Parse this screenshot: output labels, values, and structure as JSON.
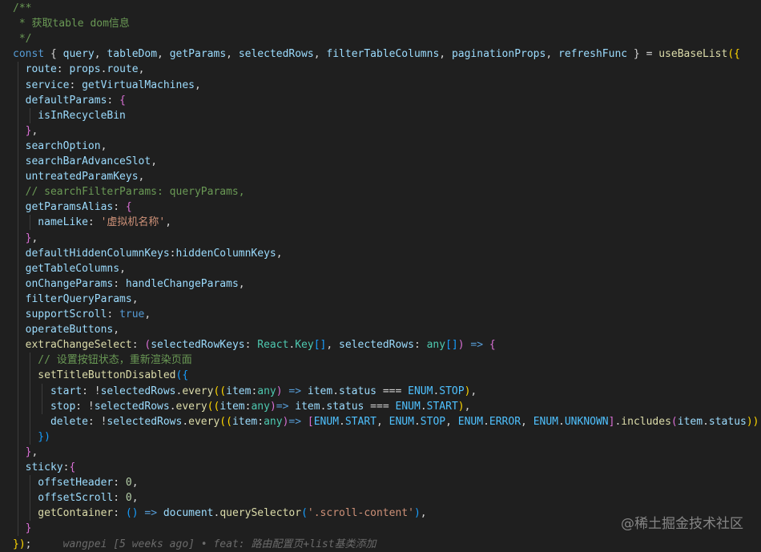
{
  "editor": {
    "lines": [
      [
        {
          "t": "/**",
          "c": "comment"
        }
      ],
      [
        {
          "t": " * 获取table dom信息",
          "c": "comment"
        }
      ],
      [
        {
          "t": " */",
          "c": "comment"
        }
      ],
      [
        {
          "t": "const",
          "c": "kw"
        },
        {
          "t": " { ",
          "c": "punc"
        },
        {
          "t": "query",
          "c": "var"
        },
        {
          "t": ", ",
          "c": "punc"
        },
        {
          "t": "tableDom",
          "c": "var"
        },
        {
          "t": ", ",
          "c": "punc"
        },
        {
          "t": "getParams",
          "c": "var"
        },
        {
          "t": ", ",
          "c": "punc"
        },
        {
          "t": "selectedRows",
          "c": "var"
        },
        {
          "t": ", ",
          "c": "punc"
        },
        {
          "t": "filterTableColumns",
          "c": "var"
        },
        {
          "t": ", ",
          "c": "punc"
        },
        {
          "t": "paginationProps",
          "c": "var"
        },
        {
          "t": ", ",
          "c": "punc"
        },
        {
          "t": "refreshFunc",
          "c": "var"
        },
        {
          "t": " } = ",
          "c": "punc"
        },
        {
          "t": "useBaseList",
          "c": "fn"
        },
        {
          "t": "({",
          "c": "brace1"
        }
      ],
      [
        {
          "t": "  route",
          "c": "var"
        },
        {
          "t": ": ",
          "c": "punc"
        },
        {
          "t": "props",
          "c": "var"
        },
        {
          "t": ".",
          "c": "punc"
        },
        {
          "t": "route",
          "c": "var"
        },
        {
          "t": ",",
          "c": "punc"
        }
      ],
      [
        {
          "t": "  service",
          "c": "var"
        },
        {
          "t": ": ",
          "c": "punc"
        },
        {
          "t": "getVirtualMachines",
          "c": "var"
        },
        {
          "t": ",",
          "c": "punc"
        }
      ],
      [
        {
          "t": "  defaultParams",
          "c": "var"
        },
        {
          "t": ": ",
          "c": "punc"
        },
        {
          "t": "{",
          "c": "brace2"
        }
      ],
      [
        {
          "t": "    isInRecycleBin",
          "c": "var"
        }
      ],
      [
        {
          "t": "  }",
          "c": "brace2"
        },
        {
          "t": ",",
          "c": "punc"
        }
      ],
      [
        {
          "t": "  searchOption",
          "c": "var"
        },
        {
          "t": ",",
          "c": "punc"
        }
      ],
      [
        {
          "t": "  searchBarAdvanceSlot",
          "c": "var"
        },
        {
          "t": ",",
          "c": "punc"
        }
      ],
      [
        {
          "t": "  untreatedParamKeys",
          "c": "var"
        },
        {
          "t": ",",
          "c": "punc"
        }
      ],
      [
        {
          "t": "  // searchFilterParams: queryParams,",
          "c": "comment"
        }
      ],
      [
        {
          "t": "  getParamsAlias",
          "c": "var"
        },
        {
          "t": ": ",
          "c": "punc"
        },
        {
          "t": "{",
          "c": "brace2"
        }
      ],
      [
        {
          "t": "    nameLike",
          "c": "var"
        },
        {
          "t": ": ",
          "c": "punc"
        },
        {
          "t": "'虚拟机名称'",
          "c": "str"
        },
        {
          "t": ",",
          "c": "punc"
        }
      ],
      [
        {
          "t": "  }",
          "c": "brace2"
        },
        {
          "t": ",",
          "c": "punc"
        }
      ],
      [
        {
          "t": "  defaultHiddenColumnKeys",
          "c": "var"
        },
        {
          "t": ":",
          "c": "punc"
        },
        {
          "t": "hiddenColumnKeys",
          "c": "var"
        },
        {
          "t": ",",
          "c": "punc"
        }
      ],
      [
        {
          "t": "  getTableColumns",
          "c": "var"
        },
        {
          "t": ",",
          "c": "punc"
        }
      ],
      [
        {
          "t": "  onChangeParams",
          "c": "var"
        },
        {
          "t": ": ",
          "c": "punc"
        },
        {
          "t": "handleChangeParams",
          "c": "var"
        },
        {
          "t": ",",
          "c": "punc"
        }
      ],
      [
        {
          "t": "  filterQueryParams",
          "c": "var"
        },
        {
          "t": ",",
          "c": "punc"
        }
      ],
      [
        {
          "t": "  supportScroll",
          "c": "var"
        },
        {
          "t": ": ",
          "c": "punc"
        },
        {
          "t": "true",
          "c": "kw"
        },
        {
          "t": ",",
          "c": "punc"
        }
      ],
      [
        {
          "t": "  operateButtons",
          "c": "var"
        },
        {
          "t": ",",
          "c": "punc"
        }
      ],
      [
        {
          "t": "  extraChangeSelect",
          "c": "fn"
        },
        {
          "t": ": ",
          "c": "punc"
        },
        {
          "t": "(",
          "c": "brace2"
        },
        {
          "t": "selectedRowKeys",
          "c": "param"
        },
        {
          "t": ": ",
          "c": "punc"
        },
        {
          "t": "React",
          "c": "type"
        },
        {
          "t": ".",
          "c": "punc"
        },
        {
          "t": "Key",
          "c": "type"
        },
        {
          "t": "[]",
          "c": "brace3"
        },
        {
          "t": ", ",
          "c": "punc"
        },
        {
          "t": "selectedRows",
          "c": "param"
        },
        {
          "t": ": ",
          "c": "punc"
        },
        {
          "t": "any",
          "c": "type"
        },
        {
          "t": "[]",
          "c": "brace3"
        },
        {
          "t": ")",
          "c": "brace2"
        },
        {
          "t": " => ",
          "c": "kw"
        },
        {
          "t": "{",
          "c": "brace2"
        }
      ],
      [
        {
          "t": "    // 设置按钮状态，重新渲染页面",
          "c": "comment"
        }
      ],
      [
        {
          "t": "    setTitleButtonDisabled",
          "c": "fn"
        },
        {
          "t": "({",
          "c": "brace3"
        }
      ],
      [
        {
          "t": "      start",
          "c": "var"
        },
        {
          "t": ": !",
          "c": "punc"
        },
        {
          "t": "selectedRows",
          "c": "var"
        },
        {
          "t": ".",
          "c": "punc"
        },
        {
          "t": "every",
          "c": "fn"
        },
        {
          "t": "((",
          "c": "brace1"
        },
        {
          "t": "item",
          "c": "param"
        },
        {
          "t": ":",
          "c": "punc"
        },
        {
          "t": "any",
          "c": "type"
        },
        {
          "t": ")",
          "c": "brace2"
        },
        {
          "t": " => ",
          "c": "kw"
        },
        {
          "t": "item",
          "c": "var"
        },
        {
          "t": ".",
          "c": "punc"
        },
        {
          "t": "status",
          "c": "var"
        },
        {
          "t": " === ",
          "c": "punc"
        },
        {
          "t": "ENUM",
          "c": "const"
        },
        {
          "t": ".",
          "c": "punc"
        },
        {
          "t": "STOP",
          "c": "const"
        },
        {
          "t": ")",
          "c": "brace1"
        },
        {
          "t": ",",
          "c": "punc"
        }
      ],
      [
        {
          "t": "      stop",
          "c": "var"
        },
        {
          "t": ": !",
          "c": "punc"
        },
        {
          "t": "selectedRows",
          "c": "var"
        },
        {
          "t": ".",
          "c": "punc"
        },
        {
          "t": "every",
          "c": "fn"
        },
        {
          "t": "((",
          "c": "brace1"
        },
        {
          "t": "item",
          "c": "param"
        },
        {
          "t": ":",
          "c": "punc"
        },
        {
          "t": "any",
          "c": "type"
        },
        {
          "t": ")",
          "c": "brace2"
        },
        {
          "t": "=> ",
          "c": "kw"
        },
        {
          "t": "item",
          "c": "var"
        },
        {
          "t": ".",
          "c": "punc"
        },
        {
          "t": "status",
          "c": "var"
        },
        {
          "t": " === ",
          "c": "punc"
        },
        {
          "t": "ENUM",
          "c": "const"
        },
        {
          "t": ".",
          "c": "punc"
        },
        {
          "t": "START",
          "c": "const"
        },
        {
          "t": ")",
          "c": "brace1"
        },
        {
          "t": ",",
          "c": "punc"
        }
      ],
      [
        {
          "t": "      delete",
          "c": "var"
        },
        {
          "t": ": !",
          "c": "punc"
        },
        {
          "t": "selectedRows",
          "c": "var"
        },
        {
          "t": ".",
          "c": "punc"
        },
        {
          "t": "every",
          "c": "fn"
        },
        {
          "t": "((",
          "c": "brace1"
        },
        {
          "t": "item",
          "c": "param"
        },
        {
          "t": ":",
          "c": "punc"
        },
        {
          "t": "any",
          "c": "type"
        },
        {
          "t": ")",
          "c": "brace2"
        },
        {
          "t": "=> ",
          "c": "kw"
        },
        {
          "t": "[",
          "c": "brace2"
        },
        {
          "t": "ENUM",
          "c": "const"
        },
        {
          "t": ".",
          "c": "punc"
        },
        {
          "t": "START",
          "c": "const"
        },
        {
          "t": ", ",
          "c": "punc"
        },
        {
          "t": "ENUM",
          "c": "const"
        },
        {
          "t": ".",
          "c": "punc"
        },
        {
          "t": "STOP",
          "c": "const"
        },
        {
          "t": ", ",
          "c": "punc"
        },
        {
          "t": "ENUM",
          "c": "const"
        },
        {
          "t": ".",
          "c": "punc"
        },
        {
          "t": "ERROR",
          "c": "const"
        },
        {
          "t": ", ",
          "c": "punc"
        },
        {
          "t": "ENUM",
          "c": "const"
        },
        {
          "t": ".",
          "c": "punc"
        },
        {
          "t": "UNKNOWN",
          "c": "const"
        },
        {
          "t": "]",
          "c": "brace2"
        },
        {
          "t": ".",
          "c": "punc"
        },
        {
          "t": "includes",
          "c": "fn"
        },
        {
          "t": "(",
          "c": "brace2"
        },
        {
          "t": "item",
          "c": "var"
        },
        {
          "t": ".",
          "c": "punc"
        },
        {
          "t": "status",
          "c": "var"
        },
        {
          "t": "))",
          "c": "brace1"
        }
      ],
      [
        {
          "t": "    })",
          "c": "brace3"
        }
      ],
      [
        {
          "t": "  }",
          "c": "brace2"
        },
        {
          "t": ",",
          "c": "punc"
        }
      ],
      [
        {
          "t": "  sticky",
          "c": "var"
        },
        {
          "t": ":",
          "c": "punc"
        },
        {
          "t": "{",
          "c": "brace2"
        }
      ],
      [
        {
          "t": "    offsetHeader",
          "c": "var"
        },
        {
          "t": ": ",
          "c": "punc"
        },
        {
          "t": "0",
          "c": "num"
        },
        {
          "t": ",",
          "c": "punc"
        }
      ],
      [
        {
          "t": "    offsetScroll",
          "c": "var"
        },
        {
          "t": ": ",
          "c": "punc"
        },
        {
          "t": "0",
          "c": "num"
        },
        {
          "t": ",",
          "c": "punc"
        }
      ],
      [
        {
          "t": "    getContainer",
          "c": "fn"
        },
        {
          "t": ": ",
          "c": "punc"
        },
        {
          "t": "()",
          "c": "brace3"
        },
        {
          "t": " => ",
          "c": "kw"
        },
        {
          "t": "document",
          "c": "var"
        },
        {
          "t": ".",
          "c": "punc"
        },
        {
          "t": "querySelector",
          "c": "fn"
        },
        {
          "t": "(",
          "c": "brace3"
        },
        {
          "t": "'.scroll-content'",
          "c": "str"
        },
        {
          "t": ")",
          "c": "brace3"
        },
        {
          "t": ",",
          "c": "punc"
        }
      ],
      [
        {
          "t": "  }",
          "c": "brace2"
        }
      ],
      [
        {
          "t": "})",
          "c": "brace1"
        },
        {
          "t": ";",
          "c": "punc"
        },
        {
          "t": "     wangpei [5 weeks ago] • feat: 路由配置页+list基类添加",
          "c": "blame"
        }
      ]
    ]
  },
  "watermark": {
    "text": "@稀土掘金技术社区"
  }
}
